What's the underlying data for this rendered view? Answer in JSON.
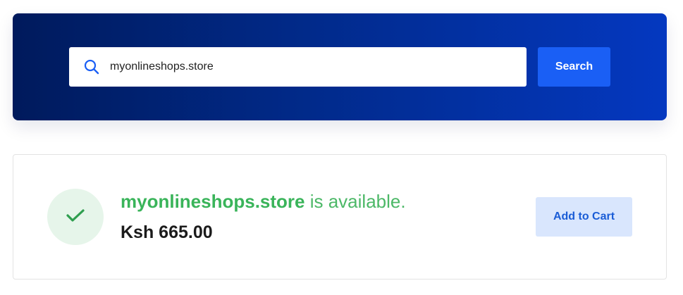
{
  "search": {
    "value": "myonlineshops.store",
    "button_label": "Search",
    "icon": "search-icon"
  },
  "result": {
    "domain": "myonlineshops.store",
    "status_suffix": " is available.",
    "price": "Ksh 665.00",
    "add_to_cart_label": "Add to Cart",
    "status_icon": "check-icon"
  },
  "colors": {
    "banner_start": "#001a5c",
    "banner_end": "#0438c0",
    "search_button": "#1a5ff5",
    "available_green": "#3ab45a",
    "check_circle_bg": "#e6f5ea",
    "add_cart_bg": "#d9e6fd",
    "add_cart_text": "#1a5cd6"
  }
}
